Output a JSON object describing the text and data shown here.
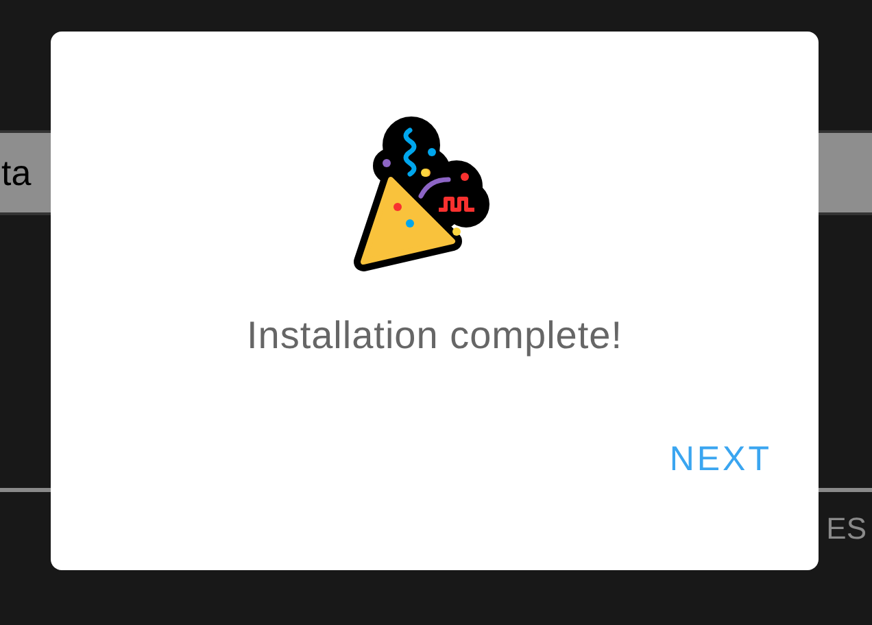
{
  "background": {
    "field_text": "ta",
    "footer_text": "ES"
  },
  "dialog": {
    "message": "Installation complete!",
    "button": "NEXT"
  }
}
